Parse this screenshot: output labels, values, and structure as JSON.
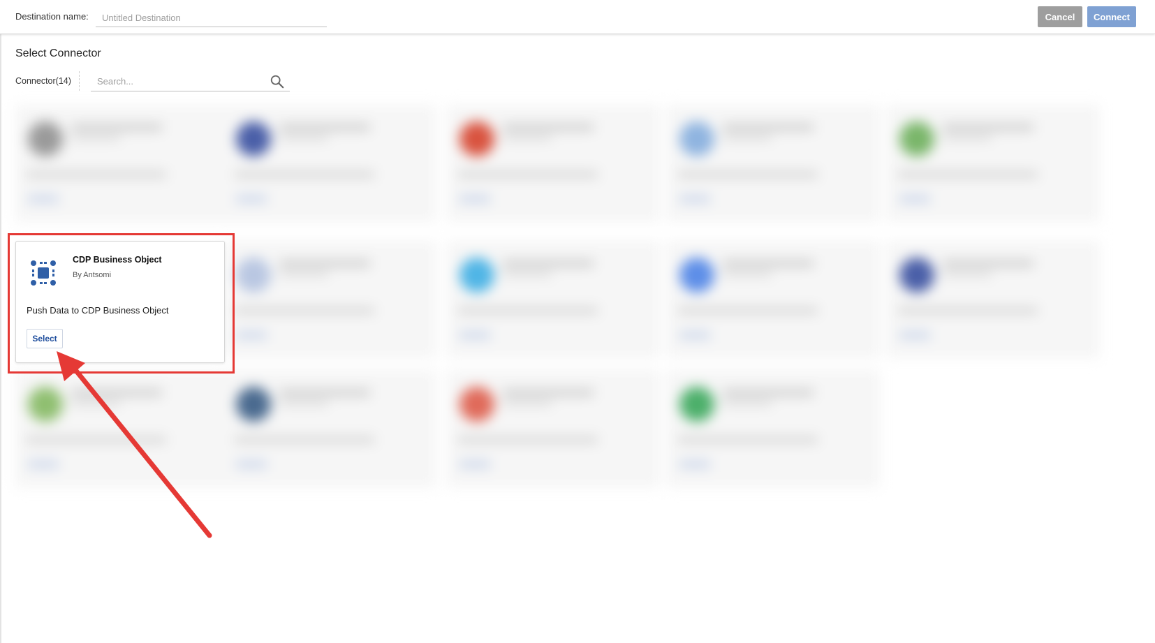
{
  "header": {
    "destination_label": "Destination name:",
    "destination_placeholder": "Untitled Destination",
    "cancel_label": "Cancel",
    "connect_label": "Connect"
  },
  "main": {
    "title": "Select Connector",
    "connector_count": "Connector(14)",
    "search_placeholder": "Search...",
    "search_icon": "search-icon"
  },
  "focused_card": {
    "title": "CDP Business Object",
    "vendor": "By Antsomi",
    "description": "Push Data to CDP Business Object",
    "select_label": "Select",
    "icon": "business-object-icon",
    "icon_color": "#2f5fa7"
  },
  "blurred_cards": [
    {
      "icon_color": "#9a9a9a"
    },
    {
      "icon_color": "#4a5fa8"
    },
    {
      "icon_color": "#d9533f"
    },
    {
      "icon_color": "#8fb4e0"
    },
    {
      "icon_color": "#7ab66a"
    },
    {
      "icon_color": "#b9c7e2"
    },
    {
      "icon_color": "#4fb5e6"
    },
    {
      "icon_color": "#5d8ee8"
    },
    {
      "icon_color": "#4a5fa8"
    },
    {
      "icon_color": "#8fbf70"
    },
    {
      "icon_color": "#4a6a8f"
    },
    {
      "icon_color": "#e06a5a"
    },
    {
      "icon_color": "#4caf6a"
    }
  ],
  "annotation": {
    "highlight_color": "#e53935"
  }
}
